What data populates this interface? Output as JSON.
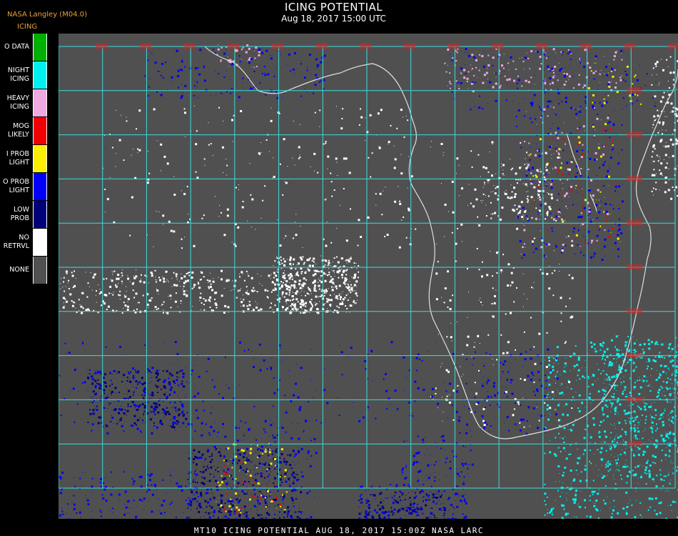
{
  "header": {
    "title": "ICING POTENTIAL",
    "subtitle": "Aug 18, 2017 15:00 UTC",
    "organization": "NASA Langley (M04.0)",
    "legend_title": "ICING"
  },
  "legend": [
    {
      "label": "O DATA",
      "color": "#00b000"
    },
    {
      "label": "NIGHT\nICING",
      "color": "#00f0f0"
    },
    {
      "label": "HEAVY\nICING",
      "color": "#f0a8e0"
    },
    {
      "label": "MOG\nLIKELY",
      "color": "#f00000"
    },
    {
      "label": "I PROB\nLIGHT",
      "color": "#f8f000"
    },
    {
      "label": "O PROB\nLIGHT",
      "color": "#0000f8"
    },
    {
      "label": "LOW\nPROB",
      "color": "#00007a"
    },
    {
      "label": "NO\nRETRVL",
      "color": "#ffffff"
    },
    {
      "label": "NONE",
      "color": "#505050"
    }
  ],
  "map": {
    "background_color": "#505050",
    "grid_color": "#3cdcdc",
    "coast_color": "#e0e0e0",
    "label_color": "#e02020",
    "grid_columns": 14,
    "grid_rows": 10
  },
  "footer": "MT10  ICING POTENTIAL   AUG 18, 2017 15:00Z   NASA LARC"
}
